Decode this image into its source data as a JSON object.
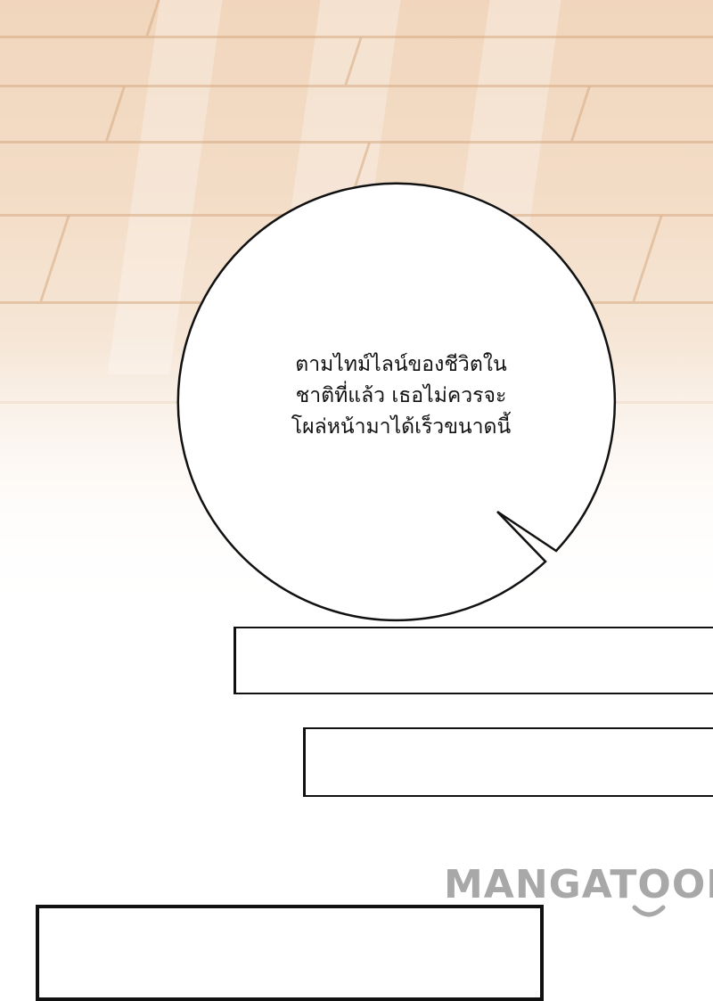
{
  "speech_bubble": {
    "lines": [
      "ตามไทม์ไลน์ของชีวิตใน",
      "ชาติที่แล้ว เธอไม่ควรจะ",
      "โผล่หน้ามาได้เร็วขนาดนี้"
    ]
  },
  "watermark": {
    "text": "MANGATOON",
    "color": "#9a9a9a"
  },
  "colors": {
    "floor": "#f1d6bd",
    "outline": "#111111",
    "page": "#ffffff"
  }
}
